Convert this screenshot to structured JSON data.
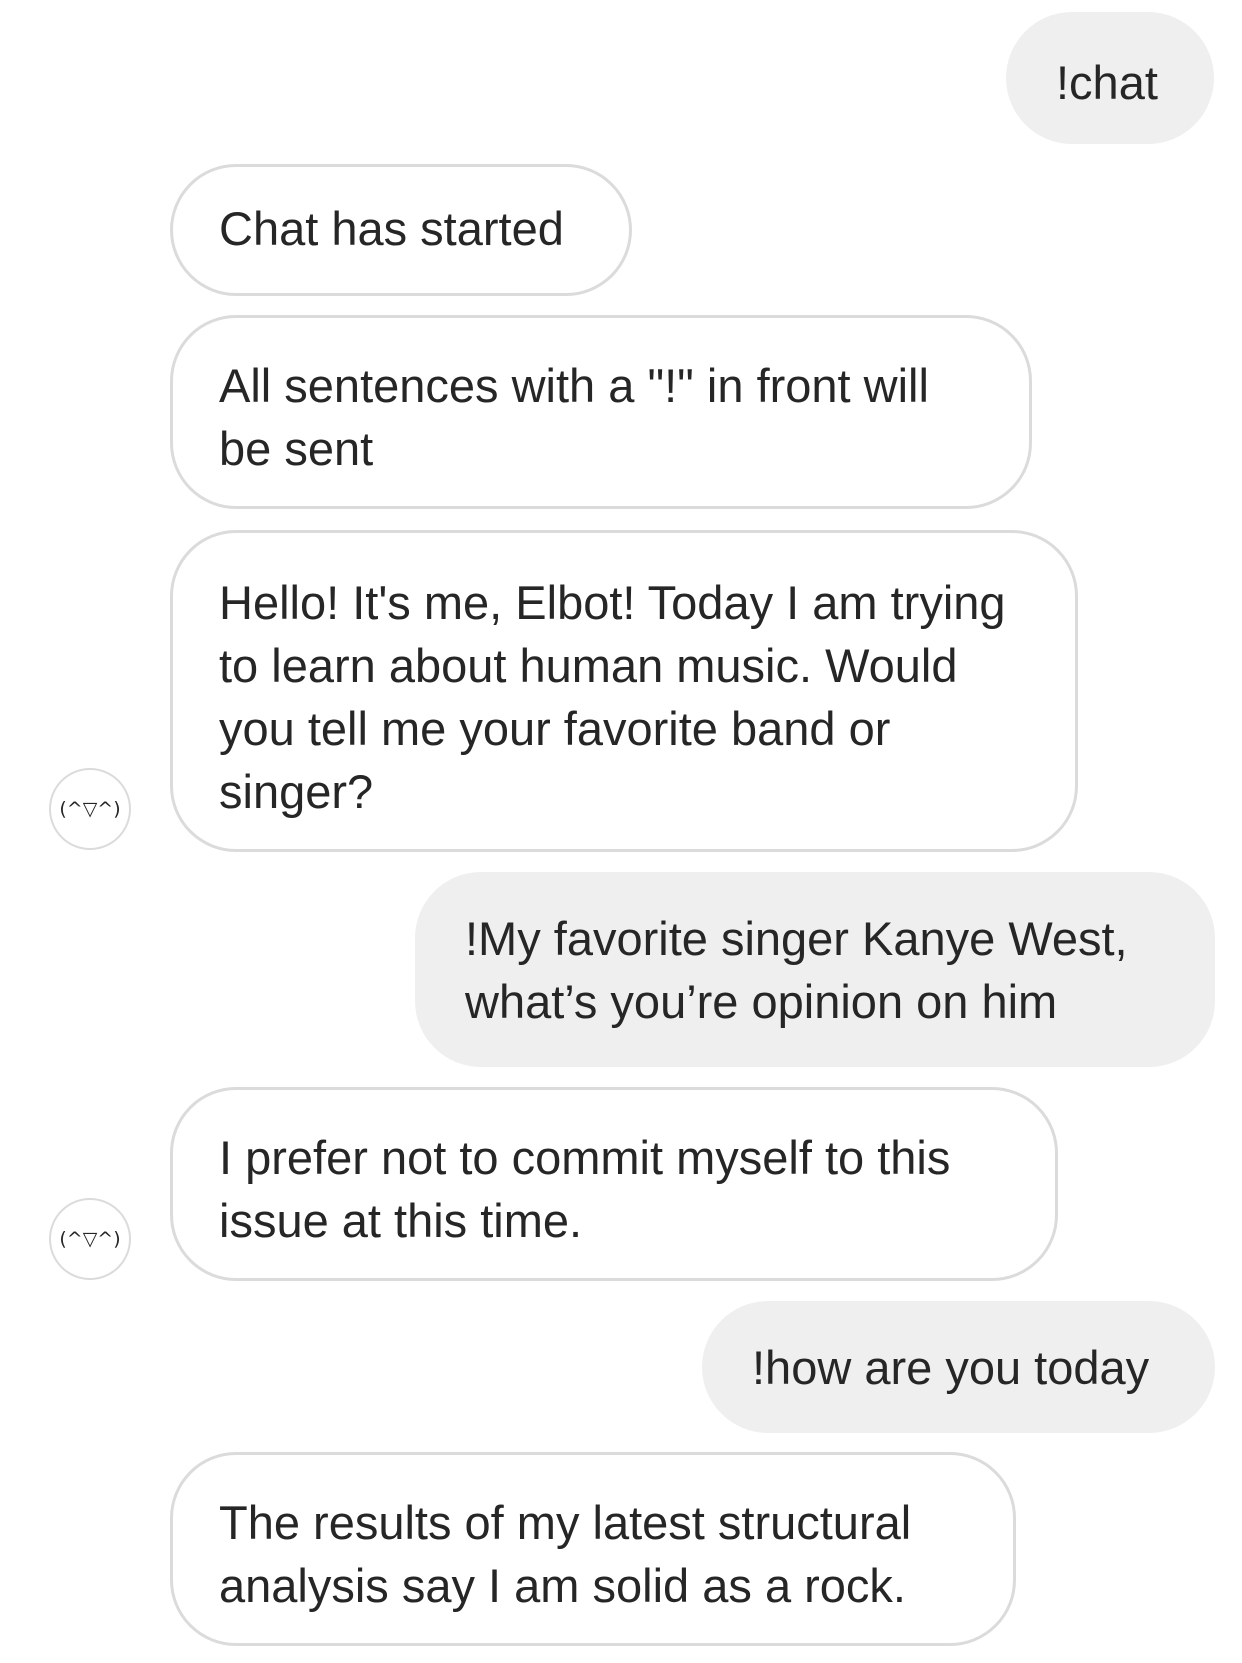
{
  "avatar_text": "(^▽^)",
  "messages": [
    {
      "direction": "sent",
      "text": "!chat"
    },
    {
      "direction": "received",
      "text": "Chat has started"
    },
    {
      "direction": "received",
      "text": "All sentences with a \"!\" in front will be sent"
    },
    {
      "direction": "received",
      "text": "Hello! It's me, Elbot! Today I am trying to learn about human music. Would you tell me your favorite band or singer?"
    },
    {
      "direction": "sent",
      "text": "!My favorite singer Kanye West, what’s you’re opinion on him"
    },
    {
      "direction": "received",
      "text": "I prefer not to commit myself to this issue at this time."
    },
    {
      "direction": "sent",
      "text": "!how are you today"
    },
    {
      "direction": "received",
      "text": "The results of my latest structural analysis say I am solid as a rock."
    }
  ]
}
